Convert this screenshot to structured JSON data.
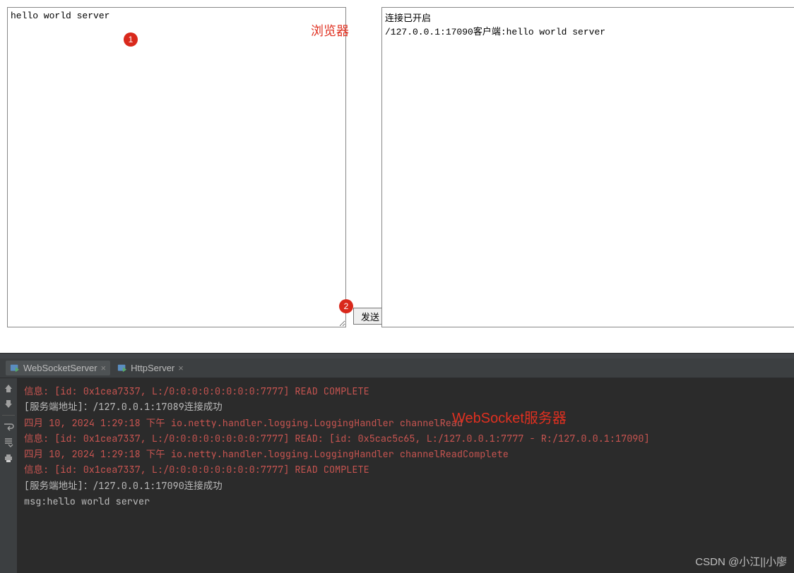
{
  "browser": {
    "input_text": "hello world server",
    "log_lines": [
      "连接已开启",
      "/127.0.0.1:17090客户端:hello world server"
    ],
    "send_label": "发送",
    "annotation_1": "1",
    "annotation_2": "2",
    "annotation_browser_label": "浏览器"
  },
  "tabs": {
    "tab1": "WebSocketServer",
    "tab2": "HttpServer"
  },
  "console": {
    "annotation_label": "WebSocket服务器",
    "lines": [
      {
        "cls": "log-red",
        "text": "信息: [id: 0x1cea7337, L:/0:0:0:0:0:0:0:0:7777] READ COMPLETE"
      },
      {
        "cls": "log-grey",
        "text": "[服务端地址]：/127.0.0.1:17089连接成功"
      },
      {
        "cls": "log-grey",
        "text": " "
      },
      {
        "cls": "log-red",
        "text": "四月 10, 2024 1:29:18 下午 io.netty.handler.logging.LoggingHandler channelRead"
      },
      {
        "cls": "log-red",
        "text": "信息: [id: 0x1cea7337, L:/0:0:0:0:0:0:0:0:7777] READ: [id: 0x5cac5c65, L:/127.0.0.1:7777 - R:/127.0.0.1:17090]"
      },
      {
        "cls": "log-red",
        "text": "四月 10, 2024 1:29:18 下午 io.netty.handler.logging.LoggingHandler channelReadComplete"
      },
      {
        "cls": "log-red",
        "text": "信息: [id: 0x1cea7337, L:/0:0:0:0:0:0:0:0:7777] READ COMPLETE"
      },
      {
        "cls": "log-grey",
        "text": "[服务端地址]：/127.0.0.1:17090连接成功"
      },
      {
        "cls": "log-grey",
        "text": " "
      },
      {
        "cls": "log-grey",
        "text": "msg:hello world server"
      }
    ]
  },
  "watermark": "CSDN @小江||小廖"
}
